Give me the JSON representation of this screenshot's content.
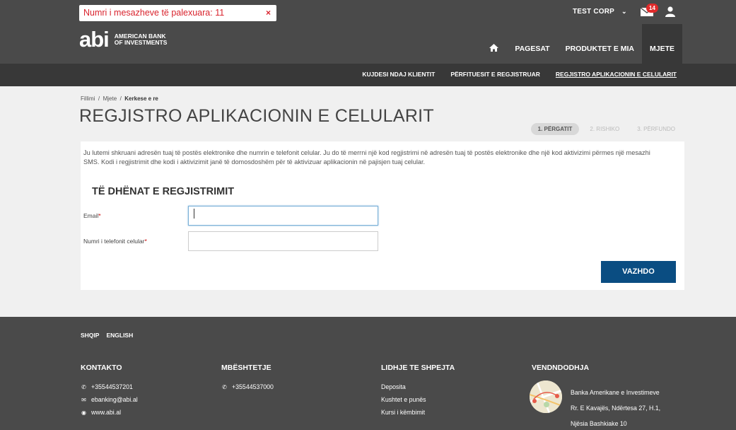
{
  "topbar": {
    "alert_text": "Numri i mesazheve të palexuara: 11",
    "alert_close": "×",
    "company": "TEST CORP",
    "mail_badge": "14"
  },
  "nav": {
    "logo_mark": "abi",
    "logo_line1": "AMERICAN BANK",
    "logo_line2": "OF INVESTMENTS",
    "items": [
      "PAGESAT",
      "PRODUKTET E MIA",
      "MJETE"
    ]
  },
  "subnav": {
    "items": [
      "KUJDESI NDAJ KLIENTIT",
      "PËRFITUESIT E REGJISTRUAR",
      "REGJISTRO APLIKACIONIN E CELULARIT"
    ]
  },
  "breadcrumb": {
    "home": "Fillimi",
    "sep": "/",
    "level2": "Mjete",
    "current": "Kerkese e re"
  },
  "page": {
    "title": "REGJISTRO APLIKACIONIN E CELULARIT",
    "steps": [
      "1. PËRGATIT",
      "2. RISHIKO",
      "3. PËRFUNDO"
    ],
    "intro": "Ju lutemi shkruani adresën tuaj të postës elektronike dhe numrin e telefonit celular. Ju do të merrni një kod regjistrimi në adresën tuaj të postës elektronike dhe një kod aktivizimi përmes një mesazhi SMS. Kodi i regjistrimit dhe kodi i aktivizimit janë të domosdoshëm për të aktivizuar aplikacionin në pajisjen tuaj celular.",
    "section_title": "TË DHËNAT E REGJISTRIMIT",
    "email_label": "Email",
    "phone_label": "Numri i telefonit celular",
    "required_mark": "*",
    "email_value": "",
    "phone_value": "",
    "continue_button": "VAZHDO"
  },
  "footer": {
    "languages": [
      "SHQIP",
      "ENGLISH"
    ],
    "contact": {
      "title": "KONTAKTO",
      "phone": "+35544537201",
      "email": "ebanking@abi.al",
      "web": "www.abi.al"
    },
    "support": {
      "title": "MBËSHTETJE",
      "phone": "+35544537000"
    },
    "links": {
      "title": "LIDHJE TE SHPEJTA",
      "items": [
        "Deposita",
        "Kushtet e punës",
        "Kursi i këmbimit"
      ]
    },
    "location": {
      "title": "VENDNDODHJA",
      "lines": [
        "Banka Amerikane e Investimeve",
        "Rr. E Kavajës, Ndërtesa 27, H.1,",
        "Njësia Bashkiake 10"
      ]
    }
  },
  "colors": {
    "header_bg": "#4a4a4a",
    "subnav_bg": "#383838",
    "alert_text": "#d9232d",
    "badge": "#e02b2b",
    "primary_button": "#0a4d82"
  }
}
